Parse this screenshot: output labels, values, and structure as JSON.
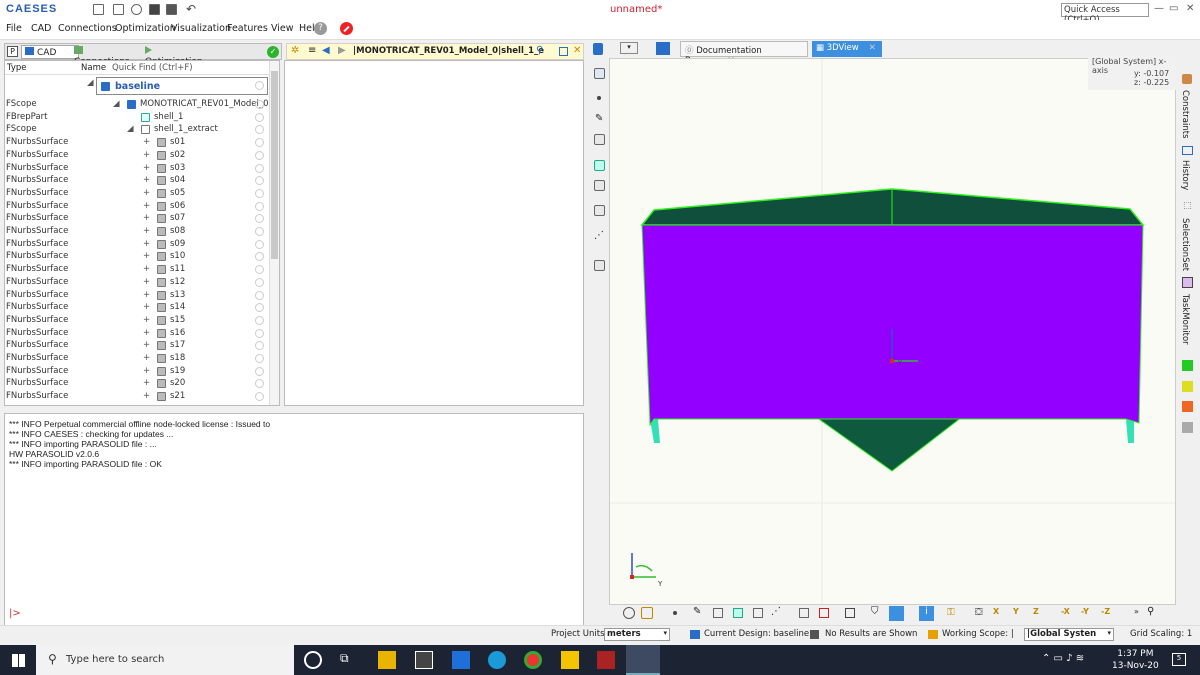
{
  "app": {
    "logo": "CAESES",
    "window_title": "unnamed*",
    "quick_access": "Quick Access (Ctrl+Q)"
  },
  "menu": [
    "File",
    "CAD",
    "Connections",
    "Optimization",
    "Visualization",
    "Features",
    "View",
    "Help"
  ],
  "left_tabs": {
    "cad": "CAD",
    "connections": "Connections",
    "optimization": "Optimization"
  },
  "tree": {
    "col_type": "Type",
    "col_name": "Name",
    "quick_find": "Quick Find (Ctrl+F)",
    "rows": [
      {
        "type": "",
        "name": "baseline"
      },
      {
        "type": "FScope",
        "name": "MONOTRICAT_REV01_Model_0"
      },
      {
        "type": "FBrepPart",
        "name": "shell_1"
      },
      {
        "type": "FScope",
        "name": "shell_1_extract"
      },
      {
        "type": "FNurbsSurface",
        "name": "s01"
      },
      {
        "type": "FNurbsSurface",
        "name": "s02"
      },
      {
        "type": "FNurbsSurface",
        "name": "s03"
      },
      {
        "type": "FNurbsSurface",
        "name": "s04"
      },
      {
        "type": "FNurbsSurface",
        "name": "s05"
      },
      {
        "type": "FNurbsSurface",
        "name": "s06"
      },
      {
        "type": "FNurbsSurface",
        "name": "s07"
      },
      {
        "type": "FNurbsSurface",
        "name": "s08"
      },
      {
        "type": "FNurbsSurface",
        "name": "s09"
      },
      {
        "type": "FNurbsSurface",
        "name": "s10"
      },
      {
        "type": "FNurbsSurface",
        "name": "s11"
      },
      {
        "type": "FNurbsSurface",
        "name": "s12"
      },
      {
        "type": "FNurbsSurface",
        "name": "s13"
      },
      {
        "type": "FNurbsSurface",
        "name": "s14"
      },
      {
        "type": "FNurbsSurface",
        "name": "s15"
      },
      {
        "type": "FNurbsSurface",
        "name": "s16"
      },
      {
        "type": "FNurbsSurface",
        "name": "s17"
      },
      {
        "type": "FNurbsSurface",
        "name": "s18"
      },
      {
        "type": "FNurbsSurface",
        "name": "s19"
      },
      {
        "type": "FNurbsSurface",
        "name": "s20"
      },
      {
        "type": "FNurbsSurface",
        "name": "s21"
      }
    ]
  },
  "editor": {
    "breadcrumb": "|MONOTRICAT_REV01_Model_0|shell_1_e"
  },
  "console": {
    "lines": [
      "*** INFO Perpetual commercial offline node-locked license : Issued to",
      "*** INFO CAESES : checking for updates ...",
      "*** INFO importing PARASOLID file : ...",
      "HW PARASOLID v2.0.6",
      "*** INFO importing PARASOLID file : OK"
    ],
    "prompt": "|>"
  },
  "right_tabs": {
    "doc_browser": "Documentation Browser",
    "view3d": "3DView"
  },
  "coords": {
    "system": "[Global System] x-axis",
    "y": "y:  -0.107",
    "z": "z:  -0.225"
  },
  "right_panels": [
    "Constraints",
    "History",
    "SelectionSet",
    "TaskMonitor"
  ],
  "status": {
    "project_units_label": "Project Units:",
    "project_units": "meters",
    "current_design": "Current Design: baseline",
    "results": "No Results are Shown",
    "working_scope": "Working Scope: |",
    "global_system": "|Global Systen",
    "grid_scaling": "Grid Scaling: 1"
  },
  "taskbar": {
    "search_placeholder": "Type here to search",
    "time": "1:37 PM",
    "date": "13-Nov-20"
  },
  "colors": {
    "hull_side": "#9400ff",
    "hull_deck": "#0f4f3c",
    "edge": "#2cf01c",
    "accent": "#2a5db0"
  }
}
